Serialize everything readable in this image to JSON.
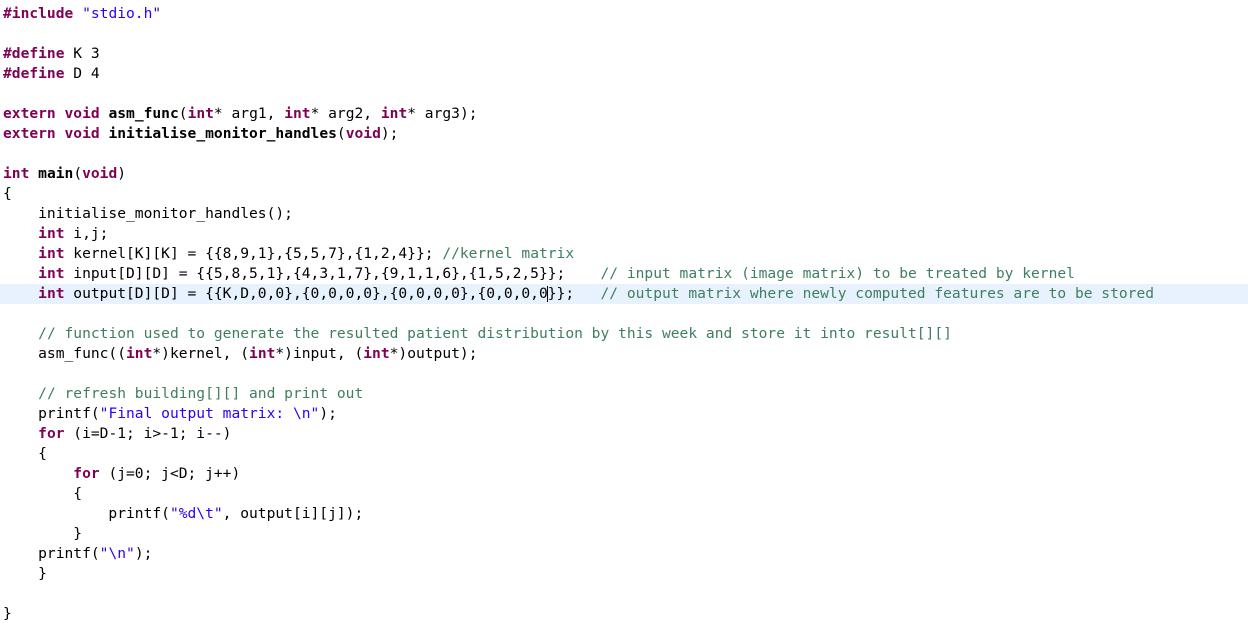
{
  "editor": {
    "language": "C",
    "current_line": 15,
    "lines": [
      [
        {
          "t": "kw",
          "v": "#include"
        },
        {
          "t": "",
          "v": " "
        },
        {
          "t": "str",
          "v": "\"stdio.h\""
        }
      ],
      [],
      [
        {
          "t": "kw",
          "v": "#define"
        },
        {
          "t": "",
          "v": " K 3"
        }
      ],
      [
        {
          "t": "kw",
          "v": "#define"
        },
        {
          "t": "",
          "v": " D 4"
        }
      ],
      [],
      [
        {
          "t": "kw",
          "v": "extern"
        },
        {
          "t": "",
          "v": " "
        },
        {
          "t": "kw",
          "v": "void"
        },
        {
          "t": "",
          "v": " "
        },
        {
          "t": "fn",
          "v": "asm_func"
        },
        {
          "t": "",
          "v": "("
        },
        {
          "t": "kw",
          "v": "int"
        },
        {
          "t": "",
          "v": "* arg1, "
        },
        {
          "t": "kw",
          "v": "int"
        },
        {
          "t": "",
          "v": "* arg2, "
        },
        {
          "t": "kw",
          "v": "int"
        },
        {
          "t": "",
          "v": "* arg3);"
        }
      ],
      [
        {
          "t": "kw",
          "v": "extern"
        },
        {
          "t": "",
          "v": " "
        },
        {
          "t": "kw",
          "v": "void"
        },
        {
          "t": "",
          "v": " "
        },
        {
          "t": "fn",
          "v": "initialise_monitor_handles"
        },
        {
          "t": "",
          "v": "("
        },
        {
          "t": "kw",
          "v": "void"
        },
        {
          "t": "",
          "v": ");"
        }
      ],
      [],
      [
        {
          "t": "kw",
          "v": "int"
        },
        {
          "t": "",
          "v": " "
        },
        {
          "t": "fn",
          "v": "main"
        },
        {
          "t": "",
          "v": "("
        },
        {
          "t": "kw",
          "v": "void"
        },
        {
          "t": "",
          "v": ")"
        }
      ],
      [
        {
          "t": "",
          "v": "{"
        }
      ],
      [
        {
          "t": "",
          "v": "    initialise_monitor_handles();"
        }
      ],
      [
        {
          "t": "",
          "v": "    "
        },
        {
          "t": "kw",
          "v": "int"
        },
        {
          "t": "",
          "v": " i,j;"
        }
      ],
      [
        {
          "t": "",
          "v": "    "
        },
        {
          "t": "kw",
          "v": "int"
        },
        {
          "t": "",
          "v": " kernel[K][K] = {{8,9,1},{5,5,7},{1,2,4}}; "
        },
        {
          "t": "cmt",
          "v": "//kernel matrix"
        }
      ],
      [
        {
          "t": "",
          "v": "    "
        },
        {
          "t": "kw",
          "v": "int"
        },
        {
          "t": "",
          "v": " input[D][D] = {{5,8,5,1},{4,3,1,7},{9,1,1,6},{1,5,2,5}};    "
        },
        {
          "t": "cmt",
          "v": "// input matrix (image matrix) to be treated by kernel"
        }
      ],
      [
        {
          "t": "",
          "v": "    "
        },
        {
          "t": "kw",
          "v": "int"
        },
        {
          "t": "",
          "v": " output[D][D] = {{K,D,0,0},{0,0,0,0},{0,0,0,0},{0,0,0,0"
        },
        {
          "t": "caret",
          "v": ""
        },
        {
          "t": "",
          "v": "}};   "
        },
        {
          "t": "cmt",
          "v": "// output matrix where newly computed features are to be stored"
        }
      ],
      [],
      [
        {
          "t": "",
          "v": "    "
        },
        {
          "t": "cmt",
          "v": "// function used to generate the resulted patient distribution by this week and store it into result[][]"
        }
      ],
      [
        {
          "t": "",
          "v": "    asm_func(("
        },
        {
          "t": "kw",
          "v": "int"
        },
        {
          "t": "",
          "v": "*)kernel, ("
        },
        {
          "t": "kw",
          "v": "int"
        },
        {
          "t": "",
          "v": "*)input, ("
        },
        {
          "t": "kw",
          "v": "int"
        },
        {
          "t": "",
          "v": "*)output);"
        }
      ],
      [],
      [
        {
          "t": "",
          "v": "    "
        },
        {
          "t": "cmt",
          "v": "// refresh building[][] and print out"
        }
      ],
      [
        {
          "t": "",
          "v": "    printf("
        },
        {
          "t": "str",
          "v": "\"Final output matrix: \\n\""
        },
        {
          "t": "",
          "v": ");"
        }
      ],
      [
        {
          "t": "",
          "v": "    "
        },
        {
          "t": "kw",
          "v": "for"
        },
        {
          "t": "",
          "v": " (i=D-1; i>-1; i--)"
        }
      ],
      [
        {
          "t": "",
          "v": "    {"
        }
      ],
      [
        {
          "t": "",
          "v": "        "
        },
        {
          "t": "kw",
          "v": "for"
        },
        {
          "t": "",
          "v": " (j=0; j<D; j++)"
        }
      ],
      [
        {
          "t": "",
          "v": "        {"
        }
      ],
      [
        {
          "t": "",
          "v": "            printf("
        },
        {
          "t": "str",
          "v": "\"%d\\t\""
        },
        {
          "t": "",
          "v": ", output[i][j]);"
        }
      ],
      [
        {
          "t": "",
          "v": "        }"
        }
      ],
      [
        {
          "t": "",
          "v": "    printf("
        },
        {
          "t": "str",
          "v": "\"\\n\""
        },
        {
          "t": "",
          "v": ");"
        }
      ],
      [
        {
          "t": "",
          "v": "    }"
        }
      ],
      [],
      [
        {
          "t": "",
          "v": "}"
        }
      ]
    ]
  }
}
